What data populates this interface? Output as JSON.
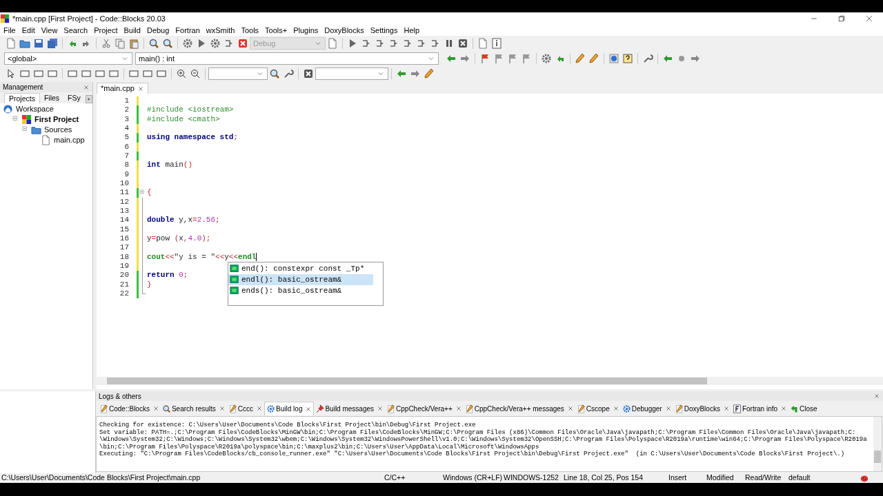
{
  "window": {
    "title": "*main.cpp [First Project] - Code::Blocks 20.03"
  },
  "menu": [
    "File",
    "Edit",
    "View",
    "Search",
    "Project",
    "Build",
    "Debug",
    "Fortran",
    "wxSmith",
    "Tools",
    "Tools+",
    "Plugins",
    "DoxyBlocks",
    "Settings",
    "Help"
  ],
  "toolbar": {
    "target_combo": {
      "value": "Debug",
      "disabled": true
    },
    "scope_combo": {
      "value": "<global>"
    },
    "function_combo": {
      "value": "main() : int"
    }
  },
  "management": {
    "title": "Management",
    "tabs": [
      {
        "label": "Projects",
        "selected": true
      },
      {
        "label": "Files",
        "selected": false
      },
      {
        "label": "FSy",
        "selected": false
      }
    ],
    "tree": [
      {
        "label": "Workspace",
        "kind": "workspace",
        "children": [
          {
            "label": "First Project",
            "kind": "project",
            "expanded": true,
            "children": [
              {
                "label": "Sources",
                "kind": "folder",
                "expanded": true,
                "children": [
                  {
                    "label": "main.cpp",
                    "kind": "file"
                  }
                ]
              }
            ]
          }
        ]
      }
    ]
  },
  "editor": {
    "tabs": [
      {
        "label": "*main.cpp",
        "selected": true
      }
    ],
    "lines": [
      {
        "number": "1",
        "saved": false
      },
      {
        "number": "2",
        "saved": true,
        "segments": [
          {
            "text": "#include <iostream>",
            "kind": "pre"
          }
        ]
      },
      {
        "number": "3",
        "saved": true,
        "segments": [
          {
            "text": "#include <cmath>",
            "kind": "pre"
          }
        ]
      },
      {
        "number": "4",
        "saved": false
      },
      {
        "number": "5",
        "saved": true,
        "segments": [
          {
            "text": "using namespace std",
            "kind": "kw"
          },
          {
            "text": ";",
            "kind": "op"
          }
        ]
      },
      {
        "number": "6",
        "saved": false
      },
      {
        "number": "7",
        "saved": true
      },
      {
        "number": "8",
        "saved": false,
        "segments": [
          {
            "text": "int",
            "kind": "kw"
          },
          {
            "text": " main",
            "kind": "id"
          },
          {
            "text": "()",
            "kind": "op"
          }
        ]
      },
      {
        "number": "9",
        "saved": false
      },
      {
        "number": "10",
        "saved": false
      },
      {
        "number": "11",
        "saved": true,
        "fold_start": true,
        "segments": [
          {
            "text": "{",
            "kind": "op"
          }
        ]
      },
      {
        "number": "12",
        "saved": false
      },
      {
        "number": "13",
        "saved": false
      },
      {
        "number": "14",
        "saved": false,
        "segments": [
          {
            "text": "double",
            "kind": "kw"
          },
          {
            "text": " y,x",
            "kind": "id"
          },
          {
            "text": "=",
            "kind": "op"
          },
          {
            "text": "2.56",
            "kind": "num"
          },
          {
            "text": ";",
            "kind": "op"
          }
        ]
      },
      {
        "number": "15",
        "saved": false
      },
      {
        "number": "16",
        "saved": false,
        "segments": [
          {
            "text": "y",
            "kind": "id"
          },
          {
            "text": "=",
            "kind": "op"
          },
          {
            "text": "pow ",
            "kind": "id"
          },
          {
            "text": "(",
            "kind": "op"
          },
          {
            "text": "x",
            "kind": "id"
          },
          {
            "text": ",",
            "kind": "op"
          },
          {
            "text": "4.0",
            "kind": "num"
          },
          {
            "text": ");",
            "kind": "op"
          }
        ]
      },
      {
        "number": "17",
        "saved": false
      },
      {
        "number": "18",
        "saved": false,
        "cursor": true,
        "segments": [
          {
            "text": "cout",
            "kind": "lib"
          },
          {
            "text": "<<",
            "kind": "op"
          },
          {
            "text": "\"y is = \"",
            "kind": "str"
          },
          {
            "text": "<<",
            "kind": "op"
          },
          {
            "text": "y",
            "kind": "id"
          },
          {
            "text": "<<",
            "kind": "op"
          },
          {
            "text": "endl",
            "kind": "lib"
          }
        ]
      },
      {
        "number": "19",
        "saved": false
      },
      {
        "number": "20",
        "saved": true,
        "segments": [
          {
            "text": "return",
            "kind": "kw"
          },
          {
            "text": " 0",
            "kind": "num"
          },
          {
            "text": ";",
            "kind": "op"
          }
        ]
      },
      {
        "number": "21",
        "saved": true,
        "segments": [
          {
            "text": "}",
            "kind": "op"
          }
        ]
      },
      {
        "number": "22",
        "saved": true,
        "fold_end": true
      }
    ],
    "autocomplete": [
      {
        "label": "end(): constexpr const _Tp*",
        "selected": false
      },
      {
        "label": "endl(): basic_ostream&",
        "selected": true
      },
      {
        "label": "ends(): basic_ostream&",
        "selected": false
      }
    ]
  },
  "logs": {
    "title": "Logs & others",
    "tabs": [
      {
        "label": "Code::Blocks",
        "kind": "note",
        "selected": false
      },
      {
        "label": "Search results",
        "kind": "search",
        "selected": false
      },
      {
        "label": "Cccc",
        "kind": "note",
        "selected": false
      },
      {
        "label": "Build log",
        "kind": "gear",
        "selected": true
      },
      {
        "label": "Build messages",
        "kind": "marker",
        "selected": false
      },
      {
        "label": "CppCheck/Vera++",
        "kind": "note",
        "selected": false
      },
      {
        "label": "CppCheck/Vera++ messages",
        "kind": "note",
        "selected": false
      },
      {
        "label": "Cscope",
        "kind": "note",
        "selected": false
      },
      {
        "label": "Debugger",
        "kind": "gear",
        "selected": false
      },
      {
        "label": "DoxyBlocks",
        "kind": "note",
        "selected": false
      },
      {
        "label": "Fortran info",
        "kind": "fortran",
        "selected": false
      },
      {
        "label": "Close",
        "kind": "back",
        "selected": false
      }
    ],
    "lines": [
      "Checking for existence: C:\\Users\\User\\Documents\\Code Blocks\\First Project\\bin\\Debug\\First Project.exe",
      "Set variable: PATH=.;C:\\Program Files\\CodeBlocks\\MinGW\\bin;C:\\Program Files\\CodeBlocks\\MinGW;C:\\Program Files (x86)\\Common Files\\Oracle\\Java\\javapath;C:\\Program Files\\Common Files\\Oracle\\Java\\javapath;C:",
      "\\Windows\\System32;C:\\Windows;C:\\Windows\\System32\\wbem;C:\\Windows\\System32\\WindowsPowerShell\\v1.0;C:\\Windows\\System32\\OpenSSH;C:\\Program Files\\Polyspace\\R2019a\\runtime\\win64;C:\\Program Files\\Polyspace\\R2019a",
      "\\bin;C:\\Program Files\\Polyspace\\R2019a\\polyspace\\bin;C:\\maxplus2\\bin;C:\\Users\\User\\AppData\\Local\\Microsoft\\WindowsApps",
      "Executing: \"C:\\Program Files\\CodeBlocks/cb_console_runner.exe\" \"C:\\Users\\User\\Documents\\Code Blocks\\First Project\\bin\\Debug\\First Project.exe\"  (in C:\\Users\\User\\Documents\\Code Blocks\\First Project\\.)"
    ]
  },
  "status_bar": {
    "path": "C:\\Users\\User\\Documents\\Code Blocks\\First Project\\main.cpp",
    "language": "C/C++",
    "line_endings": "Windows (CR+LF)",
    "encoding": "WINDOWS-1252",
    "position": "Line 18, Col 25, Pos 154",
    "mode": "Insert",
    "modified": "Modified",
    "access": "Read/Write",
    "profile": "default"
  }
}
